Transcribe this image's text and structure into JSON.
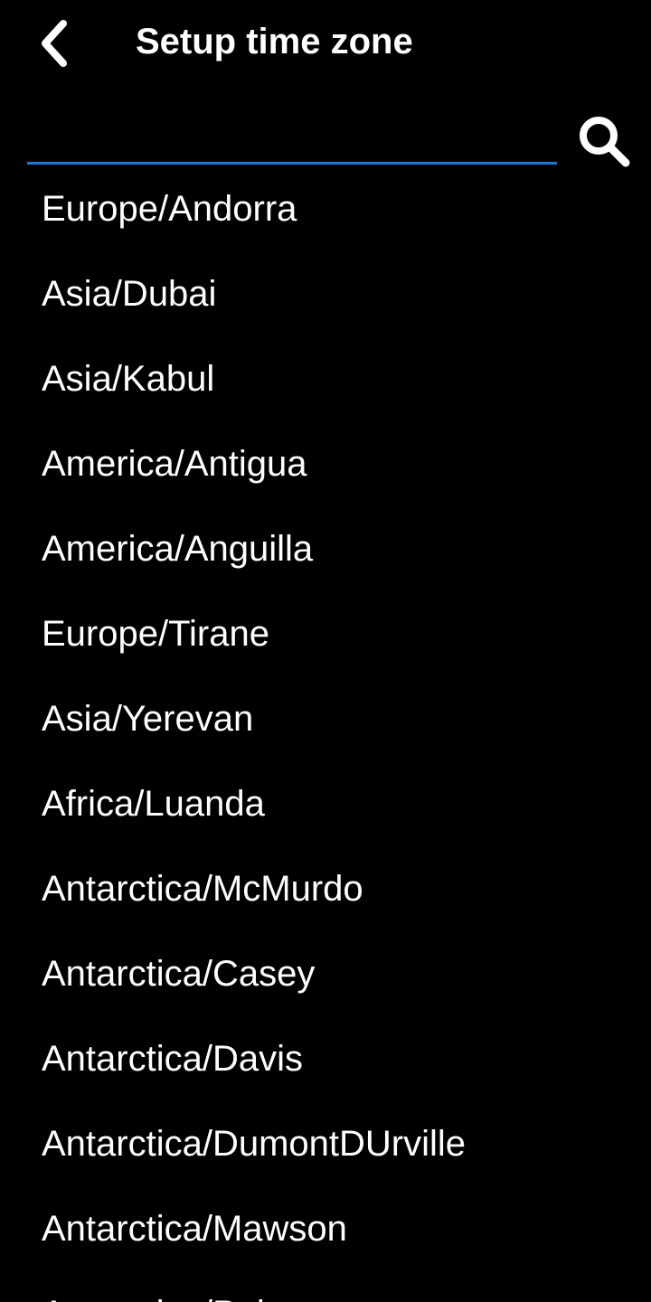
{
  "header": {
    "title": "Setup time zone",
    "back_icon": "chevron-left-icon"
  },
  "search": {
    "value": "",
    "placeholder": "",
    "icon": "search-icon",
    "underline_color": "#1e78d2"
  },
  "timezones": [
    "Europe/Andorra",
    "Asia/Dubai",
    "Asia/Kabul",
    "America/Antigua",
    "America/Anguilla",
    "Europe/Tirane",
    "Asia/Yerevan",
    "Africa/Luanda",
    "Antarctica/McMurdo",
    "Antarctica/Casey",
    "Antarctica/Davis",
    "Antarctica/DumontDUrville",
    "Antarctica/Mawson",
    "Antarctica/Palmer"
  ]
}
